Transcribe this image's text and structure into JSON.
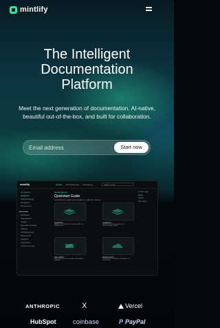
{
  "nav": {
    "brand": "mintlify",
    "menu_icon": "hamburger-icon"
  },
  "hero": {
    "title": "The Intelligent Documentation Platform",
    "subtitle": "Meet the next generation of documentation. AI-native, beautiful out-of-the-box, and built for collaboration.",
    "email_placeholder": "Email address",
    "cta_label": "Start now"
  },
  "colors": {
    "accent": "#2ee6a6",
    "background": "#05070a",
    "aurora": "#0d3b3c"
  },
  "preview": {
    "brand": "mintlify",
    "tabs": [
      "Guides",
      "API Reference",
      "Changelog"
    ],
    "search_placeholder": "Search or ask...",
    "sidebar_top": [
      "Get Started",
      "Quickstart",
      "Global Settings",
      "Navigation",
      "Components"
    ],
    "sidebar_section": "Essentials",
    "sidebar_items": [
      "Markdown",
      "Code Blocks",
      "Images",
      "Reusable Snippets",
      "Settings",
      "API Playground",
      "Deployment",
      "Analytics",
      "Integrations",
      "Custom Domain"
    ],
    "breadcrumb": "Getting Started",
    "heading": "Quickstart Guide",
    "description": "Start building modern documentation in under five minutes",
    "cards": [
      {
        "title": "Quickstart",
        "text": "Deploy your first docs in minutes with our guided setup."
      },
      {
        "title": "Installation",
        "text": "Install the CLI and preview your documentation locally."
      },
      {
        "title": "Site editing",
        "text": "Edit content in the web editor and publish instantly."
      },
      {
        "title": "Deployments",
        "text": "Connect your repository and deploy on every push."
      }
    ],
    "toc": [
      "On this page",
      "Setup",
      "Deploy",
      "Next steps"
    ]
  },
  "logos": [
    "ANTHROP\\C",
    "X",
    "Vercel",
    "HubSpot",
    "coinbase",
    "PayPal"
  ]
}
